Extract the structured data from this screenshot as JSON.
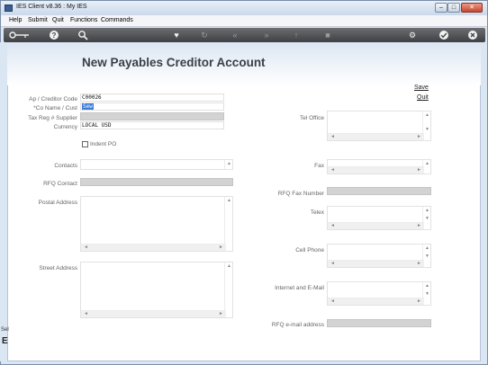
{
  "window": {
    "title": "IES Client v8.36 : My IES"
  },
  "menu": [
    "Help",
    "Submit",
    "Quit",
    "Functions",
    "Commands"
  ],
  "page": {
    "title": "New Payables Creditor Account",
    "save_link": "Save",
    "quit_link": "Quit"
  },
  "left_strip": {
    "text": "Sel",
    "glyph": "E"
  },
  "form": {
    "creditor_code": {
      "label": "Ap / Creditor Code",
      "value": "C00026"
    },
    "co_name": {
      "label": "*Co Name / Cust",
      "value": "Sew"
    },
    "tax_reg": {
      "label": "Tax Reg # Supplier",
      "value": ""
    },
    "currency": {
      "label": "Currency",
      "value": "LOCAL USD"
    },
    "indent_po": {
      "label": "Indent PO",
      "checked": false
    },
    "contacts": {
      "label": "Contacts"
    },
    "rfq_contact": {
      "label": "RFQ Contact"
    },
    "postal_address": {
      "label": "Postal Address"
    },
    "street_address": {
      "label": "Street Address"
    },
    "tel_office": {
      "label": "Tel Office"
    },
    "fax": {
      "label": "Fax"
    },
    "rfq_fax": {
      "label": "RFQ Fax Number"
    },
    "telex": {
      "label": "Telex"
    },
    "cell_phone": {
      "label": "Cell Phone"
    },
    "internet_email": {
      "label": "Internet and E-Mail"
    },
    "rfq_email": {
      "label": "RFQ e-mail address"
    }
  },
  "glyphs": {
    "up": "▲",
    "down": "▼",
    "left": "◄",
    "right": "►"
  }
}
